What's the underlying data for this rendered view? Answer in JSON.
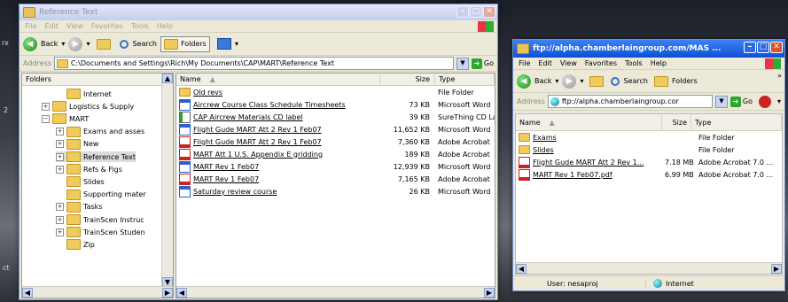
{
  "desktop": {
    "mark1": "rx",
    "mark2": "2",
    "mark3": "ct"
  },
  "win1": {
    "title": "Reference Text",
    "menu": [
      "File",
      "Edit",
      "View",
      "Favorites",
      "Tools",
      "Help"
    ],
    "toolbar": {
      "back": "Back",
      "search": "Search",
      "folders": "Folders"
    },
    "address": {
      "label": "Address",
      "value": "C:\\Documents and Settings\\Rich\\My Documents\\CAP\\MART\\Reference Text",
      "go": "Go"
    },
    "folders_header": "Folders",
    "close": "✕",
    "tree": [
      {
        "label": "Internet",
        "indent": 2,
        "exp": ""
      },
      {
        "label": "Logistics & Supply",
        "indent": 1,
        "exp": "+"
      },
      {
        "label": "MART",
        "indent": 1,
        "exp": "−"
      },
      {
        "label": "Exams and asses",
        "indent": 2,
        "exp": "+"
      },
      {
        "label": "New",
        "indent": 2,
        "exp": "+"
      },
      {
        "label": "Reference Text",
        "indent": 2,
        "exp": "+",
        "selected": true
      },
      {
        "label": "Refs & Figs",
        "indent": 2,
        "exp": "+"
      },
      {
        "label": "Slides",
        "indent": 2,
        "exp": ""
      },
      {
        "label": "Supporting mater",
        "indent": 2,
        "exp": ""
      },
      {
        "label": "Tasks",
        "indent": 2,
        "exp": "+"
      },
      {
        "label": "TrainScen Instruc",
        "indent": 2,
        "exp": "+"
      },
      {
        "label": "TrainScen Studen",
        "indent": 2,
        "exp": "+"
      },
      {
        "label": "Zip",
        "indent": 2,
        "exp": ""
      }
    ],
    "columns": {
      "name": "Name",
      "size": "Size",
      "type": "Type"
    },
    "files": [
      {
        "name": "Old revs",
        "size": "",
        "type": "File Folder",
        "icon": "folder"
      },
      {
        "name": "Aircrew Course Class Schedule Timesheets",
        "size": "73 KB",
        "type": "Microsoft Word",
        "icon": "word"
      },
      {
        "name": "CAP Aircrew Materials CD label",
        "size": "39 KB",
        "type": "SureThing CD La",
        "icon": "cd"
      },
      {
        "name": "Flight Gude MART Att 2 Rev 1 Feb07",
        "size": "11,652 KB",
        "type": "Microsoft Word",
        "icon": "word"
      },
      {
        "name": "Flight Gude MART Att 2 Rev 1 Feb07",
        "size": "7,360 KB",
        "type": "Adobe Acrobat",
        "icon": "pdf"
      },
      {
        "name": "MART Att 1 U.S. Appendix E gridding",
        "size": "189 KB",
        "type": "Adobe Acrobat",
        "icon": "pdf"
      },
      {
        "name": "MART Rev 1 Feb07",
        "size": "12,939 KB",
        "type": "Microsoft Word",
        "icon": "word"
      },
      {
        "name": "MART Rev 1 Feb07",
        "size": "7,165 KB",
        "type": "Adobe Acrobat",
        "icon": "pdf"
      },
      {
        "name": "Saturday review course",
        "size": "26 KB",
        "type": "Microsoft Word",
        "icon": "word"
      }
    ]
  },
  "win2": {
    "title": "ftp://alpha.chamberlaingroup.com/MAS ...",
    "menu": [
      "File",
      "Edit",
      "View",
      "Favorites",
      "Tools",
      "Help"
    ],
    "toolbar": {
      "back": "Back",
      "search": "Search",
      "folders": "Folders",
      "more": "»"
    },
    "address": {
      "label": "Address",
      "value": "ftp://alpha.chamberlaingroup.cor",
      "go": "Go"
    },
    "columns": {
      "name": "Name",
      "size": "Size",
      "type": "Type"
    },
    "files": [
      {
        "name": "Exams",
        "size": "",
        "type": "File Folder",
        "icon": "folder"
      },
      {
        "name": "Slides",
        "size": "",
        "type": "File Folder",
        "icon": "folder"
      },
      {
        "name": "Flight Gude MART Att 2 Rev 1...",
        "size": "7.18 MB",
        "type": "Adobe Acrobat 7.0 ...",
        "icon": "pdf"
      },
      {
        "name": "MART Rev 1 Feb07.pdf",
        "size": "6.99 MB",
        "type": "Adobe Acrobat 7.0 ...",
        "icon": "pdf"
      }
    ],
    "status": {
      "user": "User: nesaproj",
      "zone": "Internet"
    }
  }
}
